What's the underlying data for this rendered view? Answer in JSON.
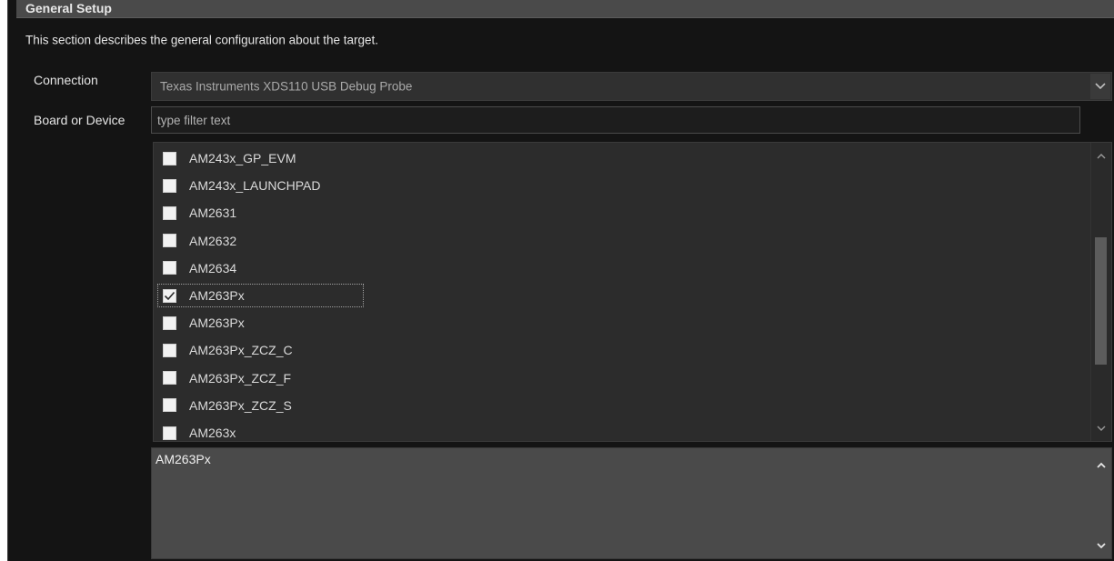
{
  "section": {
    "title": "General Setup",
    "description": "This section describes the general configuration about the target."
  },
  "connection": {
    "label": "Connection",
    "value": "Texas Instruments XDS110 USB Debug Probe"
  },
  "board_or_device": {
    "label": "Board or Device",
    "filter_placeholder": "type filter text",
    "items": [
      {
        "label": "AM243x_GP_EVM",
        "checked": false
      },
      {
        "label": "AM243x_LAUNCHPAD",
        "checked": false
      },
      {
        "label": "AM2631",
        "checked": false
      },
      {
        "label": "AM2632",
        "checked": false
      },
      {
        "label": "AM2634",
        "checked": false
      },
      {
        "label": "AM263Px",
        "checked": true,
        "focused": true
      },
      {
        "label": "AM263Px",
        "checked": false
      },
      {
        "label": "AM263Px_ZCZ_C",
        "checked": false
      },
      {
        "label": "AM263Px_ZCZ_F",
        "checked": false
      },
      {
        "label": "AM263Px_ZCZ_S",
        "checked": false
      },
      {
        "label": "AM263x",
        "checked": false
      }
    ]
  },
  "details": {
    "text": "AM263Px"
  },
  "icons": {
    "combo_arrow": "chevron-down-icon",
    "scroll_up": "chevron-up-icon",
    "scroll_down": "chevron-down-icon",
    "checkbox_checked": "check-icon"
  },
  "colors": {
    "background": "#141414",
    "header": "#4a4a4a",
    "list_background": "#2c2c2c",
    "details_background": "#4a4a4a"
  }
}
